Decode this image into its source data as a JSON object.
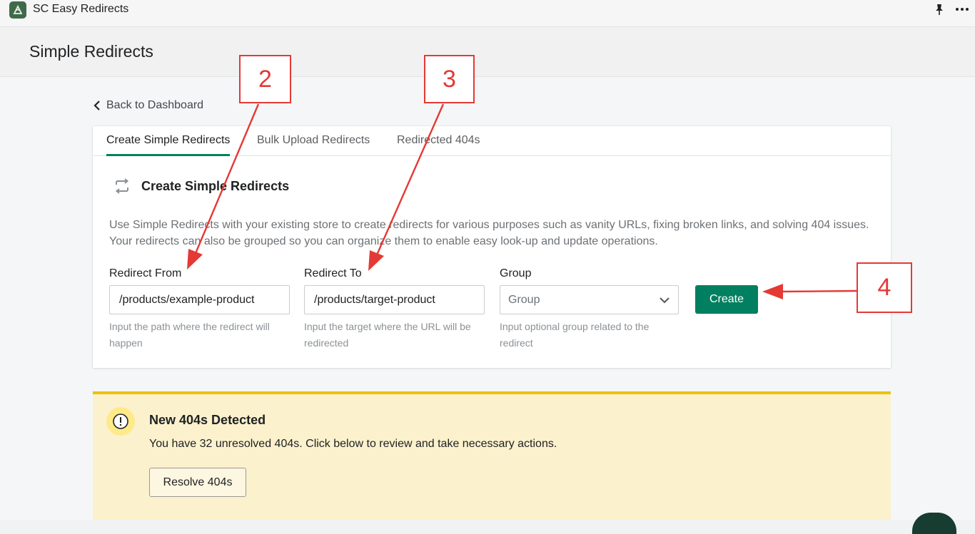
{
  "app": {
    "title": "SC Easy Redirects",
    "icons": [
      "app-logo-icon",
      "pin-icon",
      "more-horizontal-icon"
    ]
  },
  "page": {
    "title": "Simple Redirects",
    "back_link": "Back to Dashboard"
  },
  "tabs": [
    {
      "label": "Create Simple Redirects",
      "active": true
    },
    {
      "label": "Bulk Upload Redirects",
      "active": false
    },
    {
      "label": "Redirected 404s",
      "active": false
    }
  ],
  "section": {
    "title": "Create Simple Redirects",
    "description": "Use Simple Redirects with your existing store to create redirects for various purposes such as vanity URLs, fixing broken links, and solving 404 issues. Your redirects can also be grouped so you can organize them to enable easy look-up and update operations."
  },
  "form": {
    "redirect_from": {
      "label": "Redirect From",
      "value": "/products/example-product",
      "help": "Input the path where the redirect will happen"
    },
    "redirect_to": {
      "label": "Redirect To",
      "value": "/products/target-product",
      "help": "Input the target where the URL will be redirected"
    },
    "group": {
      "label": "Group",
      "placeholder": "Group",
      "help": "Input optional group related to the redirect"
    },
    "create_label": "Create"
  },
  "banner": {
    "title": "New 404s Detected",
    "text": "You have 32 unresolved 404s. Click below to review and take necessary actions.",
    "button_label": "Resolve 404s"
  },
  "annotations": {
    "callout_2": "2",
    "callout_3": "3",
    "callout_4": "4",
    "color": "#e53935"
  },
  "colors": {
    "primary": "#008060",
    "banner_bg": "#fcf1cd",
    "banner_accent": "#eec200"
  }
}
